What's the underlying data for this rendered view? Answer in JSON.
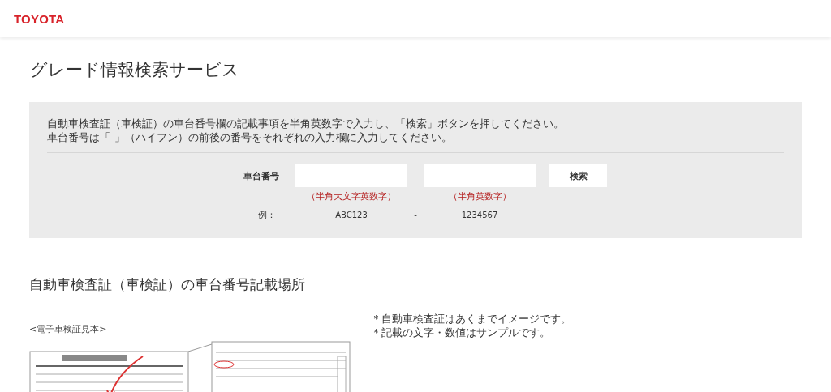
{
  "header": {
    "logo": "TOYOTA"
  },
  "title": "グレード情報検索サービス",
  "search_panel": {
    "instructions": [
      "自動車検査証（車検証）の車台番号欄の記載事項を半角英数字で入力し、「検索」ボタンを押してください。",
      "車台番号は「-」（ハイフン）の前後の番号をそれぞれの入力欄に入力してください。"
    ],
    "field_label": "車台番号",
    "separator": "-",
    "fields": [
      {
        "hint": "（半角大文字英数字）",
        "example": "ABC123"
      },
      {
        "hint": "（半角英数字）",
        "example": "1234567"
      }
    ],
    "example_label": "例：",
    "example_separator": "-",
    "button": "検索"
  },
  "location_section": {
    "heading": "自動車検査証（車検証）の車台番号記載場所",
    "caption": "<電子車検証見本>",
    "notes": [
      "＊自動車検査証はあくまでイメージです。",
      "＊記載の文字・数値はサンプルです。"
    ]
  }
}
